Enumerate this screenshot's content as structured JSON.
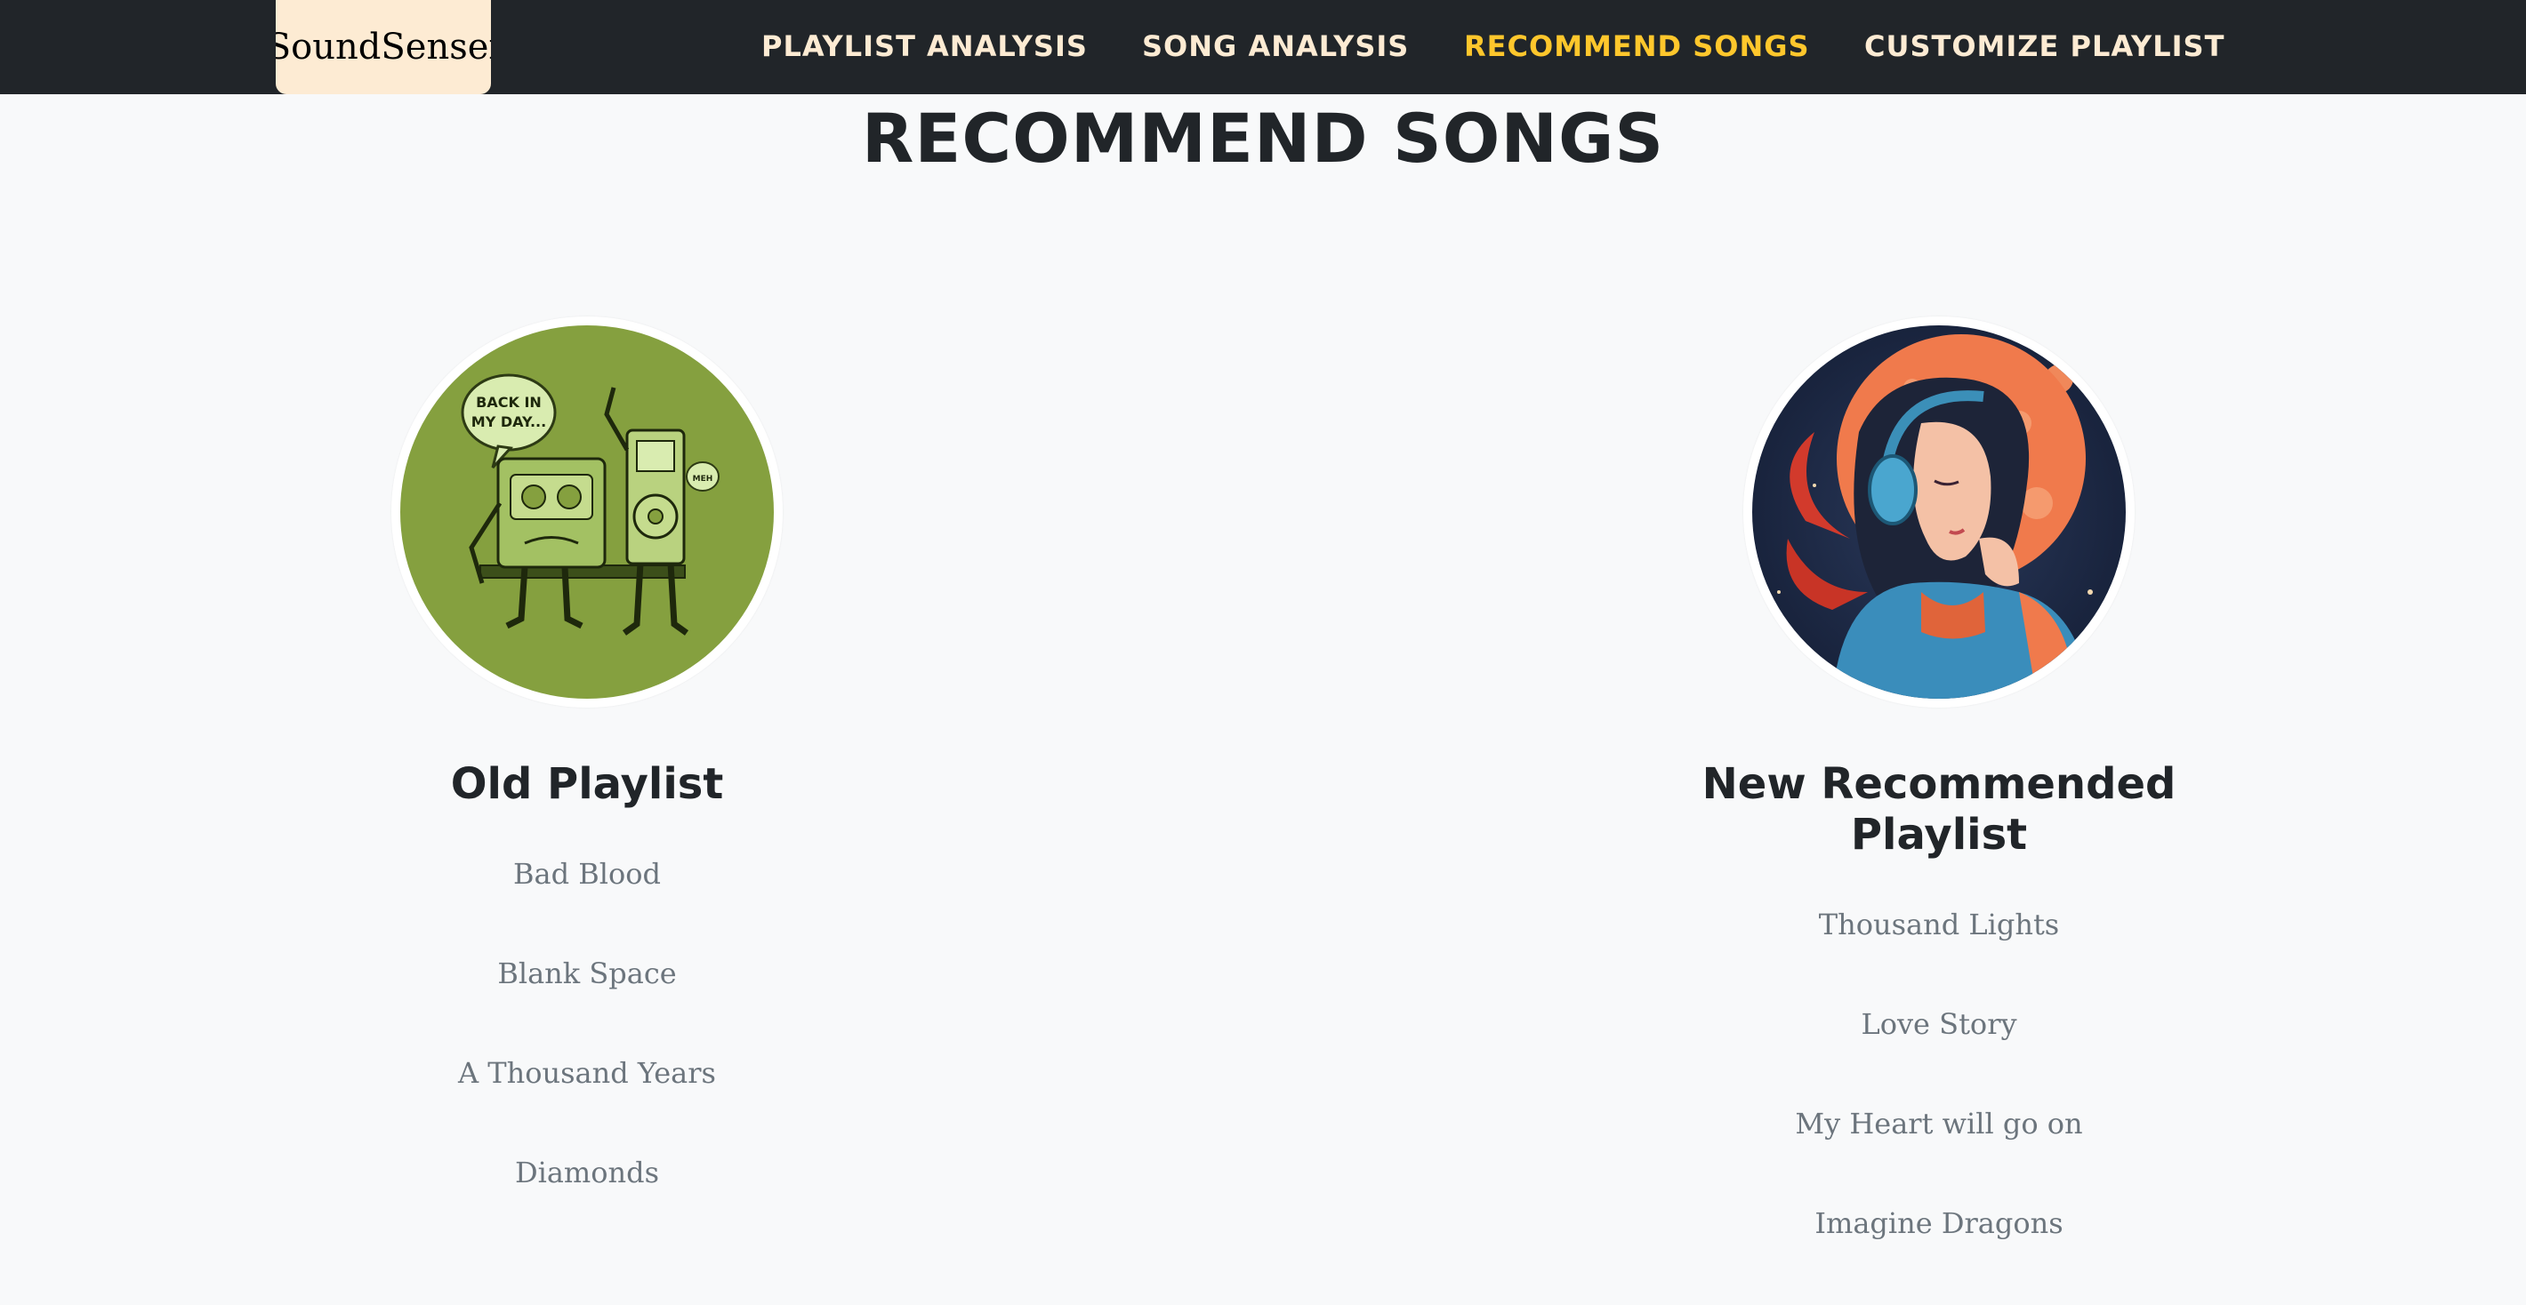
{
  "brand": {
    "name": "SoundSensei"
  },
  "nav": {
    "items": [
      {
        "label": "PLAYLIST ANALYSIS",
        "active": false
      },
      {
        "label": "SONG ANALYSIS",
        "active": false
      },
      {
        "label": "RECOMMEND SONGS",
        "active": true
      },
      {
        "label": "CUSTOMIZE PLAYLIST",
        "active": false
      }
    ]
  },
  "page": {
    "title": "RECOMMEND SONGS"
  },
  "old_playlist": {
    "title": "Old Playlist",
    "image_icon": "retro-cassette-illustration",
    "image_text": [
      "BACK IN",
      "MY DAY...",
      "MEH"
    ],
    "songs": [
      "Bad Blood",
      "Blank Space",
      "A Thousand Years",
      "Diamonds"
    ]
  },
  "new_playlist": {
    "title": "New Recommended Playlist",
    "image_icon": "girl-with-headphones-illustration",
    "songs": [
      "Thousand Lights",
      "Love Story",
      "My Heart will go on",
      "Imagine Dragons"
    ]
  },
  "colors": {
    "navbar_bg": "#212529",
    "brand_bg": "#fdebd3",
    "nav_text": "#fdebd3",
    "nav_active": "#ffc72c",
    "page_bg": "#f8f9fa",
    "heading": "#212529",
    "song_text": "#6c757d"
  }
}
